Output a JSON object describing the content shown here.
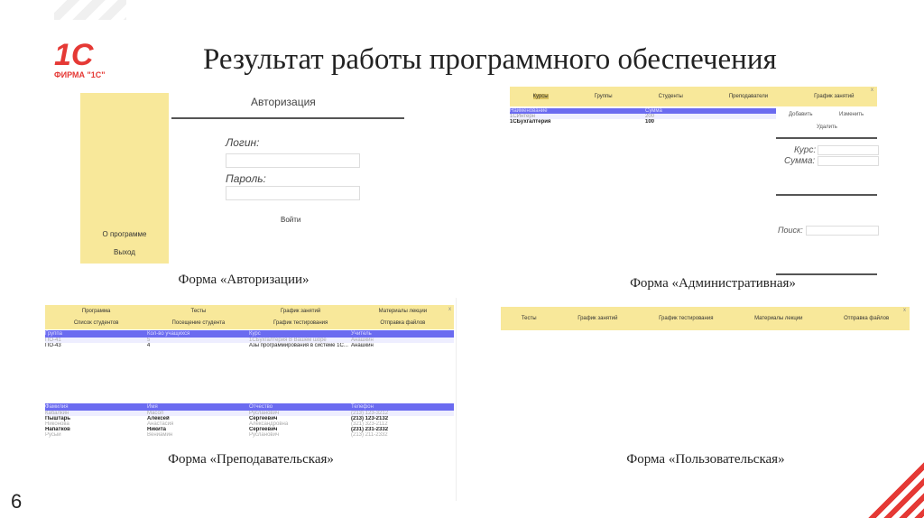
{
  "slide": {
    "title": "Результат работы программного обеспечения",
    "page_number": "6"
  },
  "logo": {
    "text": "1С",
    "subtitle": "ФИРМА \"1С\""
  },
  "auth": {
    "title": "Авторизация",
    "login_label": "Логин:",
    "password_label": "Пароль:",
    "login_button": "Войти",
    "sidebar": [
      "О программе",
      "Выход"
    ],
    "caption": "Форма «Авторизации»"
  },
  "admin": {
    "tabs": [
      "Курсы",
      "Группы",
      "Студенты",
      "Преподаватели",
      "График занятий"
    ],
    "close": "x",
    "columns": [
      "Наименование",
      "Сумма"
    ],
    "rows": [
      [
        "1СИнтерн",
        "200"
      ],
      [
        "1СБухгалтерия",
        "100"
      ]
    ],
    "buttons": {
      "add": "Добавить",
      "edit": "Изменить",
      "delete": "Удалить"
    },
    "course_label": "Курс:",
    "sum_label": "Сумма:",
    "search_label": "Поиск:",
    "caption": "Форма «Административная»"
  },
  "teacher": {
    "menu": [
      "Программа",
      "Тесты",
      "График занятий",
      "Материалы лекции",
      "Список студентов",
      "Посещение студента",
      "График тестирования",
      "Отправка файлов"
    ],
    "close": "x",
    "columns1": [
      "Группа",
      "Кол-во учащихся",
      "Курс",
      "Учитель"
    ],
    "rows1": [
      [
        "ПО-41",
        "5",
        "1СБухгалтерия В Вашем шоре",
        "Анашкин"
      ],
      [
        "ПО-43",
        "4",
        "Азы программирования в системе 1С...",
        "Анашкин"
      ]
    ],
    "columns2": [
      "Фамилия",
      "Имя",
      "Отчество",
      "Телефон"
    ],
    "rows2": [
      [
        "Кабалкин",
        "Масол",
        "Русланович",
        "(213) 123-3212"
      ],
      [
        "Пыштарь",
        "Алексей",
        "Сергеевич",
        "(213) 123-2132"
      ],
      [
        "Никонова",
        "Анастасия",
        "Александровна",
        "(321) 323-2112"
      ],
      [
        "Напатков",
        "Никита",
        "Сергеевич",
        "(231) 231-2332"
      ],
      [
        "Русый",
        "Вениамин",
        "Русланович",
        "(213) 211-2332"
      ]
    ],
    "caption": "Форма «Преподавательская»"
  },
  "user": {
    "menu": [
      "Тесты",
      "График занятий",
      "График тестирования",
      "Материалы лекции",
      "Отправка файлов"
    ],
    "close": "x",
    "caption": "Форма «Пользовательская»"
  },
  "colors": {
    "accent": "#e53935",
    "yellow": "#f8e89a",
    "blue": "#6b6bf0"
  }
}
